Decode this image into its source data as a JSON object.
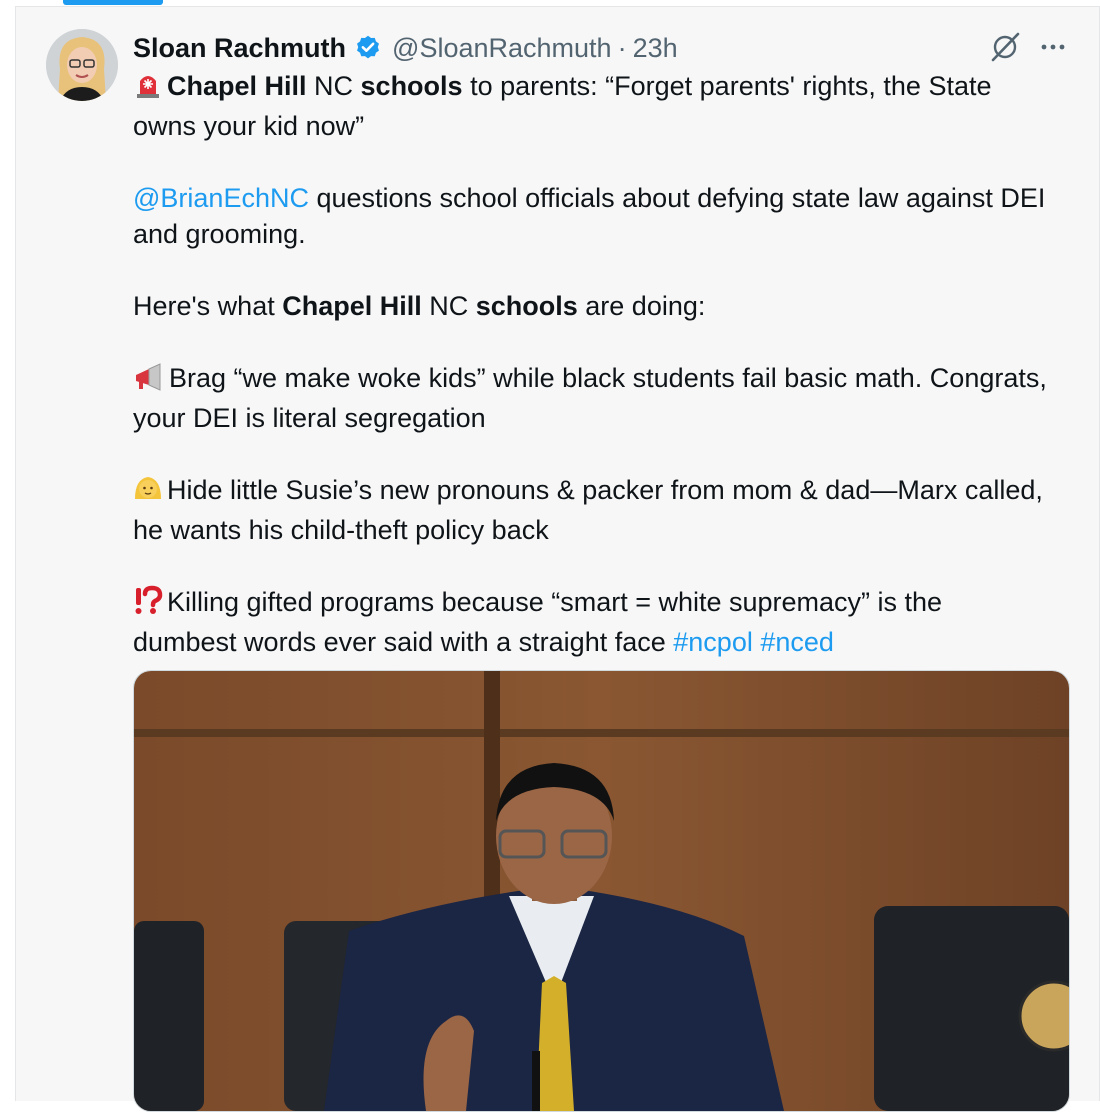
{
  "author": {
    "name": "Sloan Rachmuth",
    "handle": "@SloanRachmuth",
    "separator": "·",
    "time": "23h"
  },
  "icons": {
    "verified": "verified-badge-icon",
    "grok": "grok-icon",
    "more": "more-icon",
    "siren": "rotating-light-emoji",
    "megaphone": "megaphone-emoji",
    "child": "child-emoji",
    "interrobang": "interrobang-emoji"
  },
  "tweet": {
    "line1": {
      "b1": "Chapel Hill",
      "t1": " NC ",
      "b2": "schools",
      "t2": " to parents: “Forget parents' rights, the State owns your kid now”"
    },
    "line2": {
      "mention": "@BrianEchNC",
      "text": " questions school officials about defying state law against DEI and grooming."
    },
    "line3": {
      "t1": "Here's what ",
      "b1": "Chapel Hill",
      "t2": " NC ",
      "b2": "schools",
      "t3": " are doing:"
    },
    "line4": "Brag “we make woke kids” while black students fail basic math. Congrats, your DEI is literal segregation",
    "line5": "Hide little Susie’s new pronouns & packer from mom & dad—Marx called, he wants his child-theft policy back",
    "line6": {
      "text": "Killing gifted programs because “smart = white supremacy” is the dumbest words ever said with a straight face ",
      "tag1": "#ncpol",
      "tag2": "#nced"
    }
  },
  "colors": {
    "link": "#1d9bf0",
    "text": "#0f1419",
    "secondary": "#536471"
  }
}
